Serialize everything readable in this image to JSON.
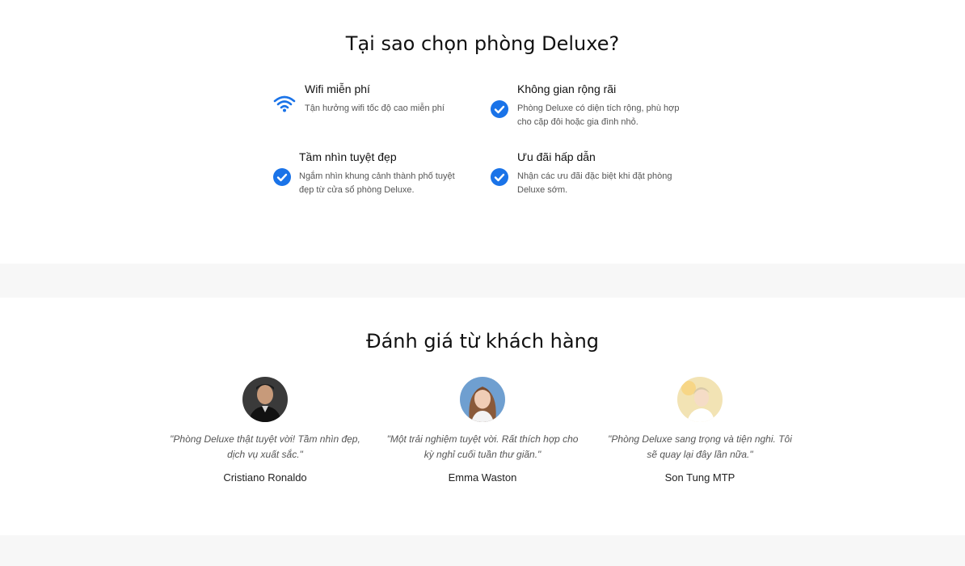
{
  "why": {
    "title": "Tại sao chọn phòng Deluxe?",
    "features": [
      {
        "icon": "wifi-icon",
        "title": "Wifi miễn phí",
        "desc": "Tận hưởng wifi tốc độ cao miễn phí"
      },
      {
        "icon": "check-circle-icon",
        "title": "Không gian rộng rãi",
        "desc": "Phòng Deluxe có diện tích rộng, phù hợp cho cặp đôi hoặc gia đình nhỏ."
      },
      {
        "icon": "check-circle-icon",
        "title": "Tầm nhìn tuyệt đẹp",
        "desc": "Ngắm nhìn khung cảnh thành phố tuyệt đẹp từ cửa sổ phòng Deluxe."
      },
      {
        "icon": "check-circle-icon",
        "title": "Ưu đãi hấp dẫn",
        "desc": "Nhận các ưu đãi đặc biệt khi đặt phòng Deluxe sớm."
      }
    ]
  },
  "reviews": {
    "title": "Đánh giá từ khách hàng",
    "items": [
      {
        "quote": "\"Phòng Deluxe thật tuyệt vời! Tầm nhìn đẹp, dịch vụ xuất sắc.\"",
        "name": "Cristiano Ronaldo"
      },
      {
        "quote": "\"Một trải nghiệm tuyệt vời. Rất thích hợp cho kỳ nghỉ cuối tuần thư giãn.\"",
        "name": "Emma Waston"
      },
      {
        "quote": "\"Phòng Deluxe sang trọng và tiện nghi. Tôi sẽ quay lại đây lần nữa.\"",
        "name": "Son Tung MTP"
      }
    ]
  },
  "colors": {
    "accent": "#1a73e8"
  }
}
